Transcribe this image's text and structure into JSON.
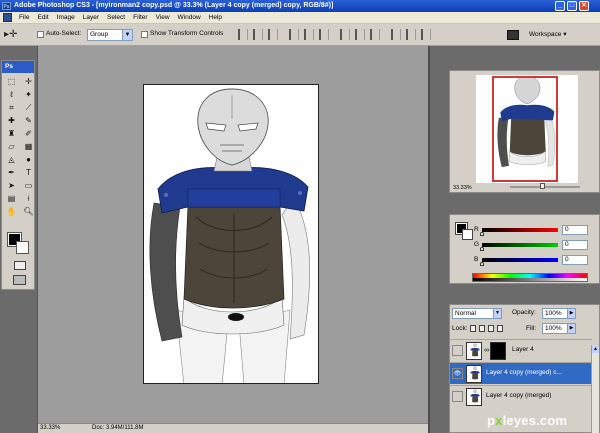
{
  "title_bar": {
    "app_icon": "Ps",
    "title": "Adobe Photoshop CS3 - [myironman2 copy.psd @ 33.3% (Layer 4 copy (merged) copy, RGB/8#)]",
    "minimize": "_",
    "maximize": "□",
    "close": "✕"
  },
  "menu": {
    "items": [
      "File",
      "Edit",
      "Image",
      "Layer",
      "Select",
      "Filter",
      "View",
      "Window",
      "Help"
    ]
  },
  "options_bar": {
    "tool_preset_icon": "move-tool-icon",
    "tool_preset_glyph": "▸✛",
    "auto_select_label": "Auto-Select:",
    "auto_select_value": "Group",
    "show_transform_label": "Show Transform Controls",
    "workspace_label": "Workspace ▾"
  },
  "toolbox": {
    "header": "Ps",
    "tools": [
      {
        "name": "marquee-tool-icon",
        "glyph": "⬚"
      },
      {
        "name": "move-tool-icon",
        "glyph": "✛"
      },
      {
        "name": "lasso-tool-icon",
        "glyph": "ℓ"
      },
      {
        "name": "magic-wand-tool-icon",
        "glyph": "✦"
      },
      {
        "name": "crop-tool-icon",
        "glyph": "⌗"
      },
      {
        "name": "slice-tool-icon",
        "glyph": "⟋"
      },
      {
        "name": "healing-brush-tool-icon",
        "glyph": "✚"
      },
      {
        "name": "brush-tool-icon",
        "glyph": "✎"
      },
      {
        "name": "clone-stamp-tool-icon",
        "glyph": "♜"
      },
      {
        "name": "history-brush-tool-icon",
        "glyph": "✐"
      },
      {
        "name": "eraser-tool-icon",
        "glyph": "▱"
      },
      {
        "name": "gradient-tool-icon",
        "glyph": "▦"
      },
      {
        "name": "blur-tool-icon",
        "glyph": "◬"
      },
      {
        "name": "dodge-tool-icon",
        "glyph": "●"
      },
      {
        "name": "pen-tool-icon",
        "glyph": "✒"
      },
      {
        "name": "type-tool-icon",
        "glyph": "T"
      },
      {
        "name": "path-selection-tool-icon",
        "glyph": "➤"
      },
      {
        "name": "shape-tool-icon",
        "glyph": "▭"
      },
      {
        "name": "notes-tool-icon",
        "glyph": "▤"
      },
      {
        "name": "eyedropper-tool-icon",
        "glyph": "⟊"
      },
      {
        "name": "hand-tool-icon",
        "glyph": "✋"
      },
      {
        "name": "zoom-tool-icon",
        "glyph": "🔍︎"
      }
    ]
  },
  "document": {
    "zoom": "33.33%",
    "doc_size": "Doc: 3.94M/111.8M"
  },
  "navigator": {
    "zoom": "33.33%"
  },
  "color_panel": {
    "channels": [
      {
        "label": "R",
        "value": "0",
        "gradient": [
          "#000000",
          "#ff0000"
        ]
      },
      {
        "label": "G",
        "value": "0",
        "gradient": [
          "#000000",
          "#00cc00"
        ]
      },
      {
        "label": "B",
        "value": "0",
        "gradient": [
          "#000000",
          "#0000ff"
        ]
      }
    ]
  },
  "layers_panel": {
    "blend_mode": "Normal",
    "opacity_label": "Opacity:",
    "opacity_value": "100%",
    "lock_label": "Lock:",
    "fill_label": "Fill:",
    "fill_value": "100%",
    "layers": [
      {
        "name": "Layer 4",
        "visible": false,
        "active": false,
        "has_mask": true
      },
      {
        "name": "Layer 4 copy (merged) c...",
        "visible": true,
        "active": true,
        "has_mask": false
      },
      {
        "name": "Layer 4 copy (merged)",
        "visible": false,
        "active": false,
        "has_mask": false
      }
    ]
  },
  "watermark": {
    "prefix": "p",
    "x": "x",
    "suffix": "leyes.com"
  },
  "colors": {
    "title_bar": "#0b3fb5",
    "active_layer": "#316ac5",
    "navigator_box": "#d23a3a",
    "armor_blue": "#1f3a8f",
    "armor_dark": "#4c4539"
  }
}
